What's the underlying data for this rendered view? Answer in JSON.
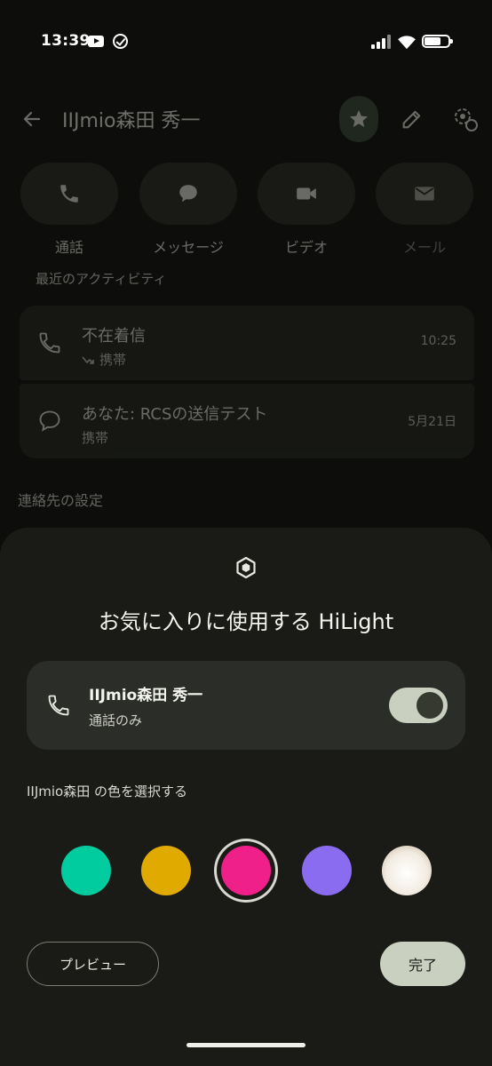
{
  "status": {
    "time": "13:39"
  },
  "header": {
    "title": "IIJmio森田 秀一"
  },
  "actions": [
    {
      "label": "通話",
      "icon": "phone-icon"
    },
    {
      "label": "メッセージ",
      "icon": "message-icon"
    },
    {
      "label": "ビデオ",
      "icon": "video-icon"
    },
    {
      "label": "メール",
      "icon": "mail-icon"
    }
  ],
  "activity": {
    "title": "最近のアクティビティ",
    "items": [
      {
        "main": "不在着信",
        "sub": "携帯",
        "time": "10:25",
        "icon": "phone-icon"
      },
      {
        "main": "あなた: RCSの送信テスト",
        "sub": "携帯",
        "time": "5月21日",
        "icon": "message-icon"
      }
    ]
  },
  "contact_settings_title": "連絡先の設定",
  "sheet": {
    "title": "お気に入りに使用する HiLight",
    "favorite": {
      "name": "IIJmio森田 秀一",
      "sub": "通話のみ",
      "enabled": true
    },
    "color_label": "IIJmio森田 の色を選択する",
    "colors": [
      {
        "hex": "#00cca0",
        "selected": false
      },
      {
        "hex": "#e0aa00",
        "selected": false
      },
      {
        "hex": "#f0208a",
        "selected": true
      },
      {
        "hex": "#8a6cf0",
        "selected": false
      },
      {
        "hex": "#f2ece2",
        "selected": false
      }
    ],
    "preview_label": "プレビュー",
    "done_label": "完了"
  },
  "theme": {
    "accent": "#c9d0c0",
    "sheet_bg": "#1a1b17"
  }
}
